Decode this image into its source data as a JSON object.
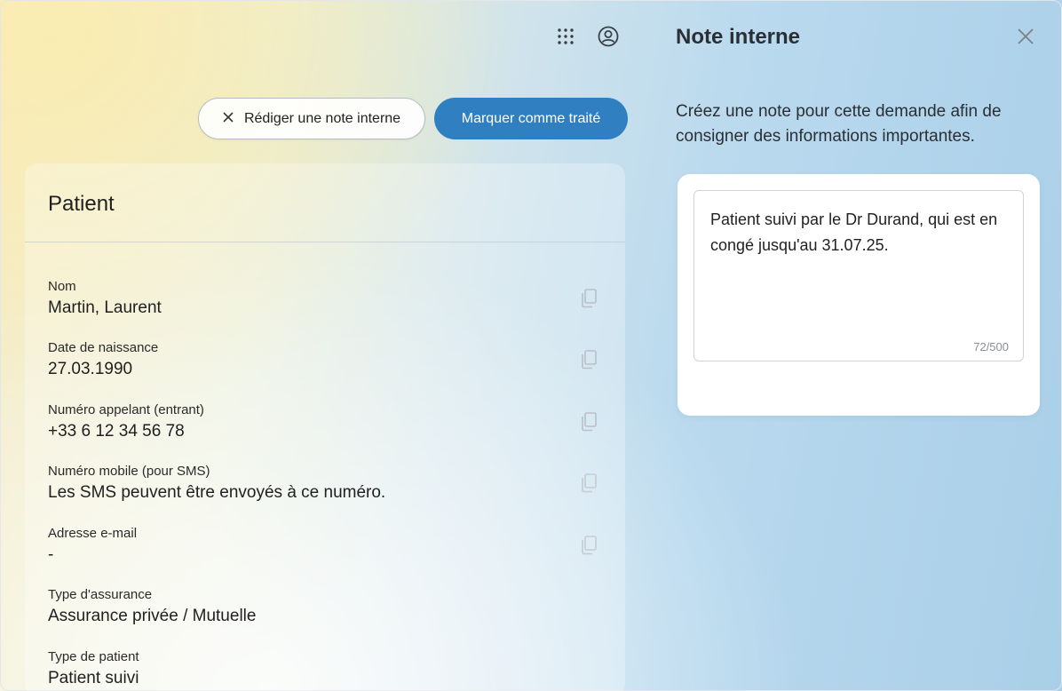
{
  "toolbar": {
    "icons": [
      "grid-icon",
      "account-icon"
    ]
  },
  "actions": {
    "note_button_label": "Rédiger une note interne",
    "mark_done_label": "Marquer comme traité"
  },
  "patient": {
    "title": "Patient",
    "fields": [
      {
        "label": "Nom",
        "value": "Martin, Laurent"
      },
      {
        "label": "Date de naissance",
        "value": "27.03.1990"
      },
      {
        "label": "Numéro appelant (entrant)",
        "value": "+33 6 12 34 56 78"
      },
      {
        "label": "Numéro mobile (pour SMS)",
        "value": "Les SMS peuvent être envoyés à ce numéro."
      },
      {
        "label": "Adresse e-mail",
        "value": "-"
      },
      {
        "label": "Type d'assurance",
        "value": "Assurance privée / Mutuelle"
      },
      {
        "label": "Type de patient",
        "value": "Patient suivi"
      }
    ]
  },
  "panel": {
    "title": "Note interne",
    "description": "Créez une note pour cette demande afin de consigner des informations importantes.",
    "note_text": "Patient suivi par le Dr Durand, qui est en congé jusqu'au 31.07.25.",
    "counter": "72/500"
  },
  "colors": {
    "primary": "#2f7fc1"
  }
}
